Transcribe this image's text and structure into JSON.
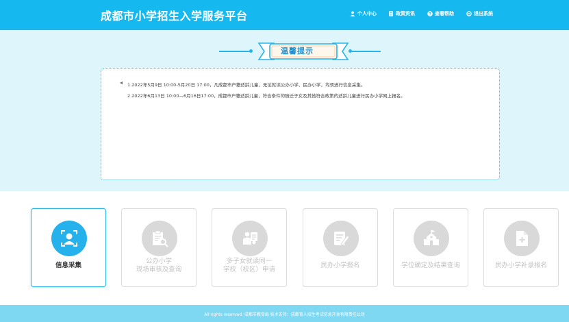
{
  "header": {
    "title": "成都市小学招生入学服务平台",
    "nav": [
      {
        "label": "个人中心",
        "icon": "user-icon"
      },
      {
        "label": "政策资讯",
        "icon": "document-icon"
      },
      {
        "label": "查看帮助",
        "icon": "help-icon"
      },
      {
        "label": "退出系统",
        "icon": "logout-icon"
      }
    ]
  },
  "notice": {
    "title": "温馨提示",
    "lines": [
      "1.2022年5月9日 10:00-5月20日 17:00，凡成都市户籍适龄儿童，无论就读公办小学、民办小学，均须进行信息采集。",
      "2.2022年6月13日 10:00—6月16日17:00，成都市户籍适龄儿童，符合条件的随迁子女及其他符合政策的适龄儿童进行民办小学网上报名。"
    ]
  },
  "cards": [
    {
      "lines": [
        "信息采集"
      ],
      "icon": "person-scan-icon",
      "active": true
    },
    {
      "lines": [
        "公办小学",
        "现场审核及查询"
      ],
      "icon": "clipboard-search-icon",
      "active": false
    },
    {
      "lines": [
        "多子女就读同一",
        "学校（校区）申请"
      ],
      "icon": "children-icon",
      "active": false
    },
    {
      "lines": [
        "民办小学报名"
      ],
      "icon": "form-edit-icon",
      "active": false
    },
    {
      "lines": [
        "学位确定及结果查询"
      ],
      "icon": "school-building-icon",
      "active": false
    },
    {
      "lines": [
        "民办小学补录报名"
      ],
      "icon": "file-add-icon",
      "active": false
    }
  ],
  "footer": {
    "text": "All rights reserved. 成都市教育局   技术支持：成都育人招生考试信息开发有限责任公司"
  },
  "colors": {
    "header": "#16b8f0",
    "notice_bg": "#def5fc",
    "accent": "#24b1ec",
    "footer": "#7ed8f2",
    "disabled": "#d9d9d9"
  }
}
